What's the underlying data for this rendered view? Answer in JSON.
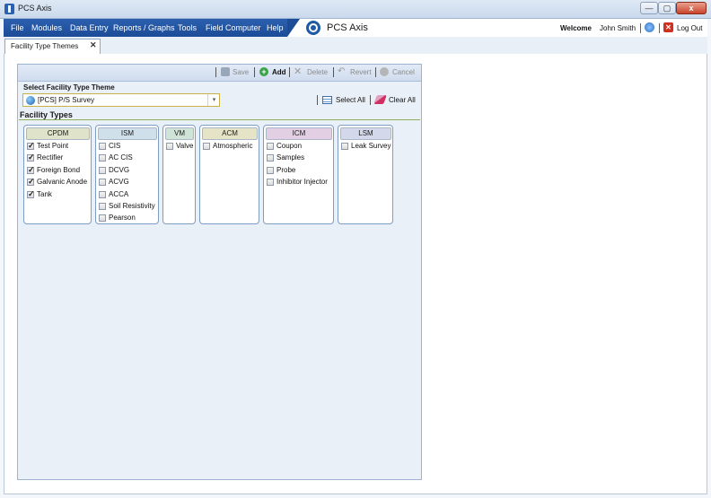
{
  "window": {
    "title": "PCS Axis",
    "minimize_glyph": "—",
    "maximize_glyph": "▢",
    "close_glyph": "x"
  },
  "menu": {
    "items": [
      "File",
      "Modules",
      "Data Entry",
      "Reports / Graphs",
      "Tools",
      "Field Computer",
      "Help"
    ],
    "brand": "PCS Axis",
    "welcome": "Welcome",
    "user": "John Smith",
    "logout": "Log Out"
  },
  "tab": {
    "label": "Facility Type Themes",
    "close_glyph": "✕"
  },
  "toolbar": {
    "save": "Save",
    "add": "Add",
    "add_glyph": "+",
    "delete": "Delete",
    "delete_glyph": "✕",
    "revert": "Revert",
    "revert_glyph": "↶",
    "cancel": "Cancel"
  },
  "theme": {
    "label": "Select Facility Type Theme",
    "value": "[PCS] P/S Survey",
    "arrow_glyph": "▾",
    "select_all": "Select All",
    "clear_all": "Clear All"
  },
  "facility_types_label": "Facility Types",
  "groups": [
    {
      "name": "CPDM",
      "color": "#dfe3c9",
      "items": [
        {
          "label": "Test Point",
          "checked": true
        },
        {
          "label": "Rectifier",
          "checked": true
        },
        {
          "label": "Foreign Bond",
          "checked": true
        },
        {
          "label": "Galvanic Anode",
          "checked": true
        },
        {
          "label": "Tank",
          "checked": true
        }
      ]
    },
    {
      "name": "ISM",
      "color": "#cfe0ea",
      "items": [
        {
          "label": "CIS",
          "checked": false
        },
        {
          "label": "AC CIS",
          "checked": false
        },
        {
          "label": "DCVG",
          "checked": false
        },
        {
          "label": "ACVG",
          "checked": false
        },
        {
          "label": "ACCA",
          "checked": false
        },
        {
          "label": "Soil Resistivity",
          "checked": false
        },
        {
          "label": "Pearson",
          "checked": false
        }
      ]
    },
    {
      "name": "VM",
      "color": "#cfe3d6",
      "items": [
        {
          "label": "Valve",
          "checked": false
        }
      ]
    },
    {
      "name": "ACM",
      "color": "#e6e4c6",
      "items": [
        {
          "label": "Atmospheric",
          "checked": false
        }
      ]
    },
    {
      "name": "ICM",
      "color": "#e3cfe3",
      "items": [
        {
          "label": "Coupon",
          "checked": false
        },
        {
          "label": "Samples",
          "checked": false
        },
        {
          "label": "Probe",
          "checked": false
        },
        {
          "label": "Inhibitor Injector",
          "checked": false
        }
      ]
    },
    {
      "name": "LSM",
      "color": "#d3d9ea",
      "items": [
        {
          "label": "Leak Survey",
          "checked": false
        }
      ]
    }
  ]
}
